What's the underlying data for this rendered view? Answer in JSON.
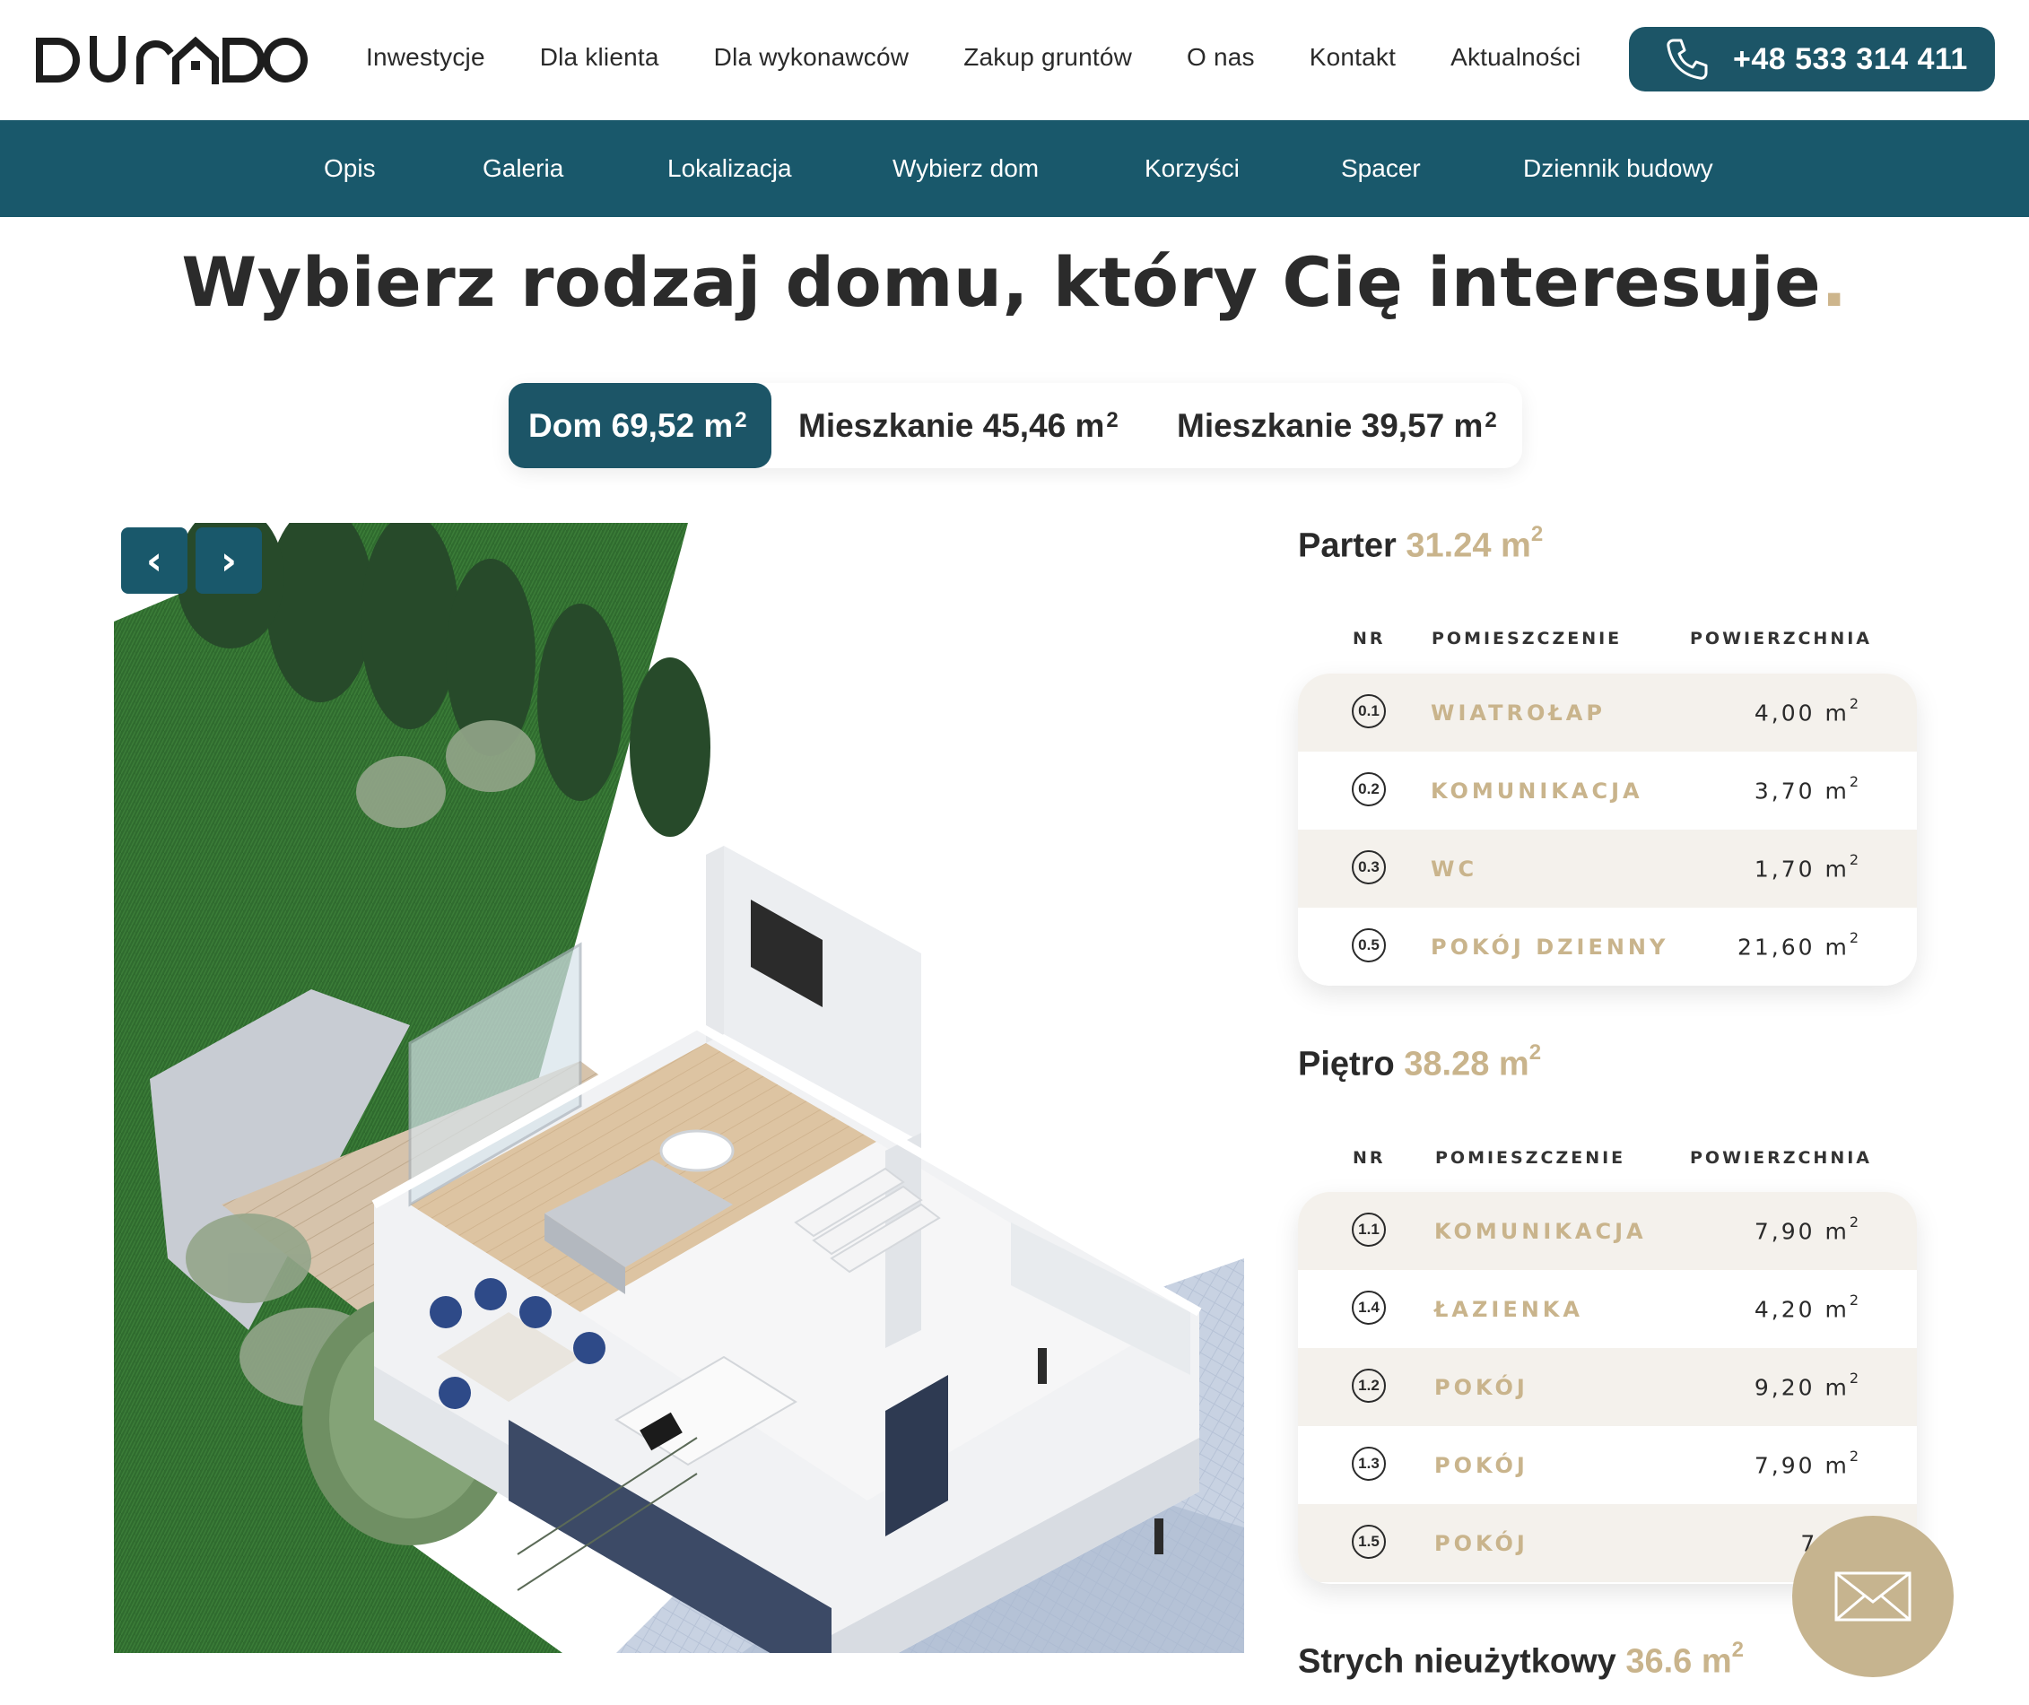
{
  "brand": {
    "logo_text": "DURADO"
  },
  "main_nav": [
    {
      "label": "Inwestycje"
    },
    {
      "label": "Dla klienta"
    },
    {
      "label": "Dla wykonawców"
    },
    {
      "label": "Zakup gruntów"
    },
    {
      "label": "O nas"
    },
    {
      "label": "Kontakt"
    },
    {
      "label": "Aktualności"
    }
  ],
  "phone": {
    "number": "+48 533 314 411",
    "icon": "phone-icon"
  },
  "sub_nav": [
    {
      "label": "Opis"
    },
    {
      "label": "Galeria"
    },
    {
      "label": "Lokalizacja"
    },
    {
      "label": "Wybierz dom"
    },
    {
      "label": "Korzyści"
    },
    {
      "label": "Spacer"
    },
    {
      "label": "Dziennik budowy"
    }
  ],
  "heading": {
    "text": "Wybierz rodzaj domu, który Cię interesuje",
    "dot": "."
  },
  "tabs": [
    {
      "label": "Dom 69,52 m",
      "sup": "2",
      "active": true
    },
    {
      "label": "Mieszkanie 45,46 m",
      "sup": "2",
      "active": false
    },
    {
      "label": "Mieszkanie 39,57 m",
      "sup": "2",
      "active": false
    }
  ],
  "gallery": {
    "prev": "‹",
    "next": "›"
  },
  "column_headers": {
    "nr": "NR",
    "room": "POMIESZCZENIE",
    "area": "POWIERZCHNIA"
  },
  "floors": [
    {
      "name": "Parter",
      "area": "31.24 m",
      "sup": "2",
      "rooms": [
        {
          "nr": "0.1",
          "name": "WIATROŁAP",
          "area": "4,00 m",
          "sup": "2"
        },
        {
          "nr": "0.2",
          "name": "KOMUNIKACJA",
          "area": "3,70 m",
          "sup": "2"
        },
        {
          "nr": "0.3",
          "name": "WC",
          "area": "1,70 m",
          "sup": "2"
        },
        {
          "nr": "0.5",
          "name": "POKÓJ DZIENNY",
          "area": "21,60 m",
          "sup": "2"
        }
      ]
    },
    {
      "name": "Piętro",
      "area": "38.28 m",
      "sup": "2",
      "rooms": [
        {
          "nr": "1.1",
          "name": "KOMUNIKACJA",
          "area": "7,90 m",
          "sup": "2"
        },
        {
          "nr": "1.4",
          "name": "ŁAZIENKA",
          "area": "4,20 m",
          "sup": "2"
        },
        {
          "nr": "1.2",
          "name": "POKÓJ",
          "area": "9,20 m",
          "sup": "2"
        },
        {
          "nr": "1.3",
          "name": "POKÓJ",
          "area": "7,90 m",
          "sup": "2"
        },
        {
          "nr": "1.5",
          "name": "POKÓJ",
          "area": "7,40",
          "sup": ""
        }
      ]
    },
    {
      "name": "Strych nieużytkowy",
      "area": "36.6 m",
      "sup": "2",
      "rooms": []
    }
  ],
  "colors": {
    "primary": "#19586b",
    "accent": "#c9b48c",
    "row_alt": "#f4f1ec"
  },
  "mail_button": {
    "icon": "envelope-icon"
  }
}
